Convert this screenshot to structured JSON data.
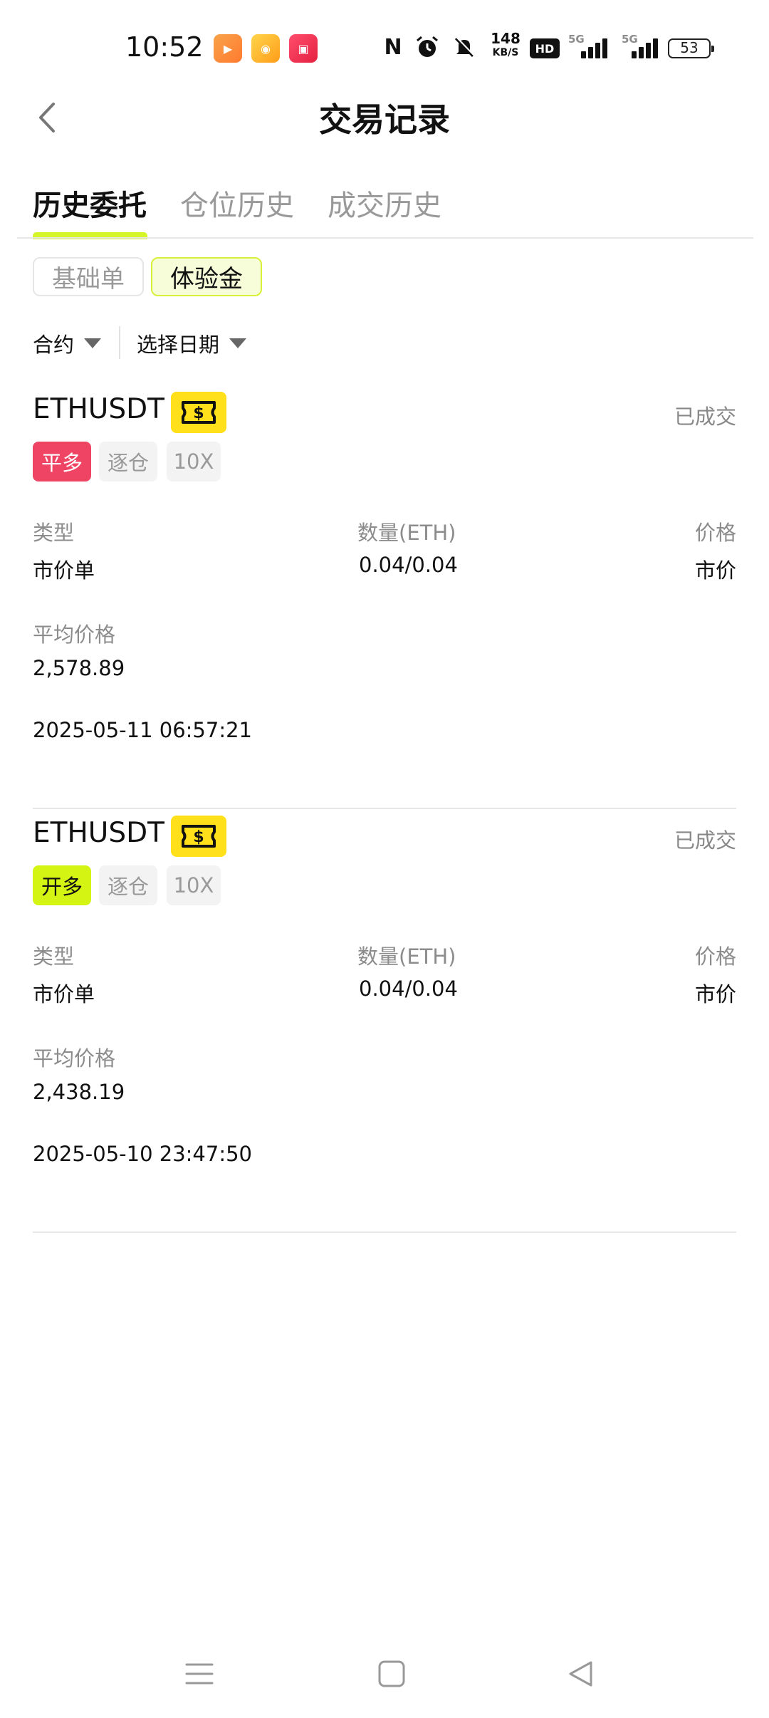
{
  "status_bar": {
    "time": "10:52",
    "net_speed": "148",
    "net_speed_unit": "KB/S",
    "hd_label": "HD",
    "signal1_label": "5G",
    "signal2_label": "5G",
    "battery": "53"
  },
  "header": {
    "title": "交易记录"
  },
  "tabs": [
    {
      "label": "历史委托",
      "active": true
    },
    {
      "label": "仓位历史",
      "active": false
    },
    {
      "label": "成交历史",
      "active": false
    }
  ],
  "sub_tabs": [
    {
      "label": "基础单",
      "active": false
    },
    {
      "label": "体验金",
      "active": true
    }
  ],
  "filters": {
    "contract": "合约",
    "date": "选择日期"
  },
  "orders": [
    {
      "symbol": "ETHUSDT",
      "status": "已成交",
      "side": "平多",
      "margin_mode": "逐仓",
      "leverage": "10X",
      "type_label": "类型",
      "type_value": "市价单",
      "qty_label": "数量(ETH)",
      "qty_value": "0.04/0.04",
      "price_label": "价格",
      "price_value": "市价",
      "avg_label": "平均价格",
      "avg_value": "2,578.89",
      "time": "2025-05-11 06:57:21"
    },
    {
      "symbol": "ETHUSDT",
      "status": "已成交",
      "side": "开多",
      "margin_mode": "逐仓",
      "leverage": "10X",
      "type_label": "类型",
      "type_value": "市价单",
      "qty_label": "数量(ETH)",
      "qty_value": "0.04/0.04",
      "price_label": "价格",
      "price_value": "市价",
      "avg_label": "平均价格",
      "avg_value": "2,438.19",
      "time": "2025-05-10 23:47:50"
    }
  ],
  "colors": {
    "accent": "#d6f526",
    "close_long": "#ef4464",
    "open_long": "#d4f514",
    "badge": "#ffe01a"
  },
  "icons": {
    "back": "chevron-left-icon",
    "badge": "trial-fund-ticket-icon",
    "nav_menu": "menu-icon",
    "nav_home": "home-square-icon",
    "nav_back": "triangle-back-icon"
  }
}
